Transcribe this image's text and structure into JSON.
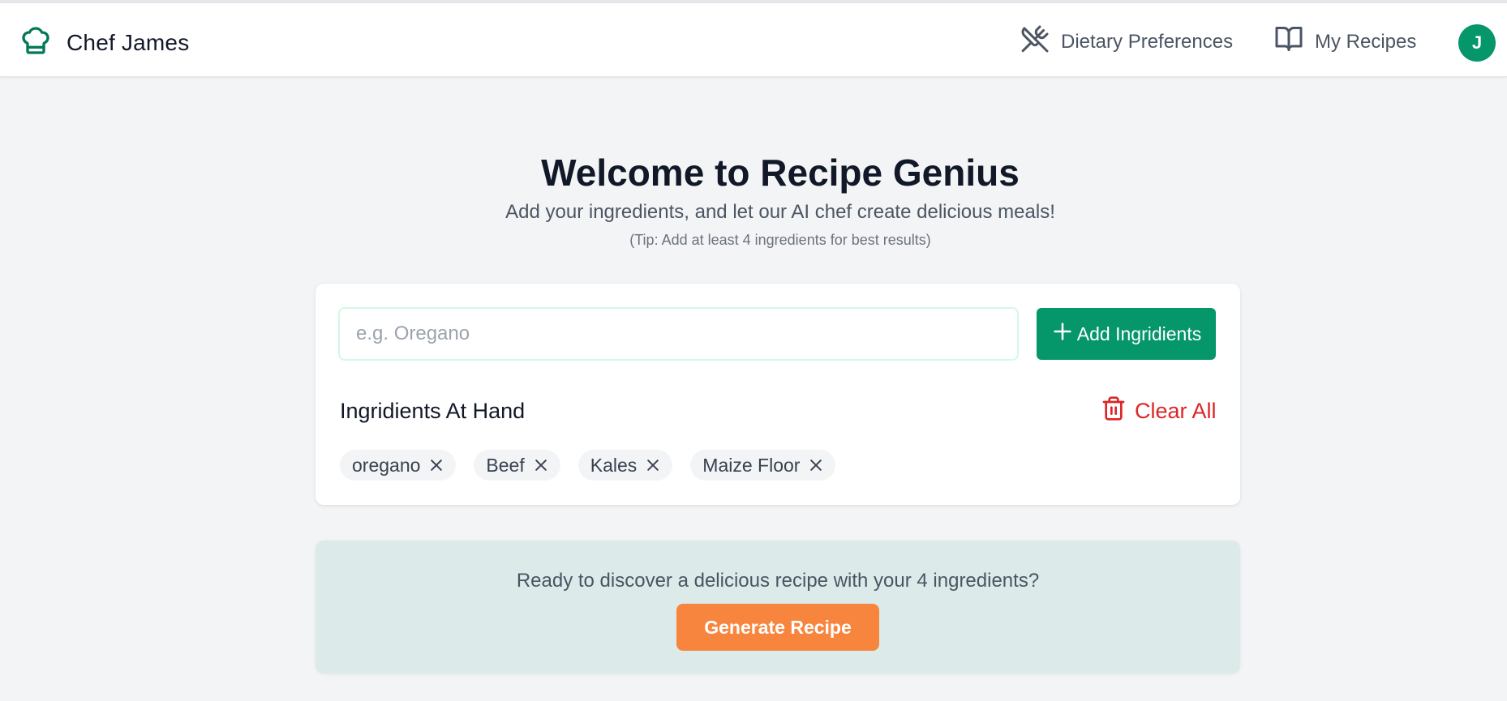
{
  "app": {
    "brand_name": "Chef James",
    "brand_icon": "chef-hat-icon"
  },
  "nav": {
    "dietary_label": "Dietary Preferences",
    "dietary_icon": "utensils-crossed-icon",
    "recipes_label": "My Recipes",
    "recipes_icon": "book-open-icon",
    "avatar_initial": "J"
  },
  "hero": {
    "title": "Welcome to Recipe Genius",
    "subtitle": "Add your ingredients, and let our AI chef create delicious meals!",
    "tip": "(Tip: Add at least 4 ingredients for best results)"
  },
  "ingredient_form": {
    "input_value": "",
    "input_placeholder": "e.g. Oregano",
    "add_button_label": "Add Ingridients"
  },
  "ingredients": {
    "section_title": "Ingridients At Hand",
    "clear_label": "Clear All",
    "items": [
      {
        "label": "oregano"
      },
      {
        "label": "Beef"
      },
      {
        "label": "Kales"
      },
      {
        "label": "Maize Floor"
      }
    ]
  },
  "cta": {
    "prompt": "Ready to discover a delicious recipe with your 4 ingredients?",
    "button_label": "Generate Recipe"
  },
  "colors": {
    "primary": "#059669",
    "danger": "#dc2626",
    "accent": "#f8853d",
    "cta_background": "#dceae9"
  }
}
